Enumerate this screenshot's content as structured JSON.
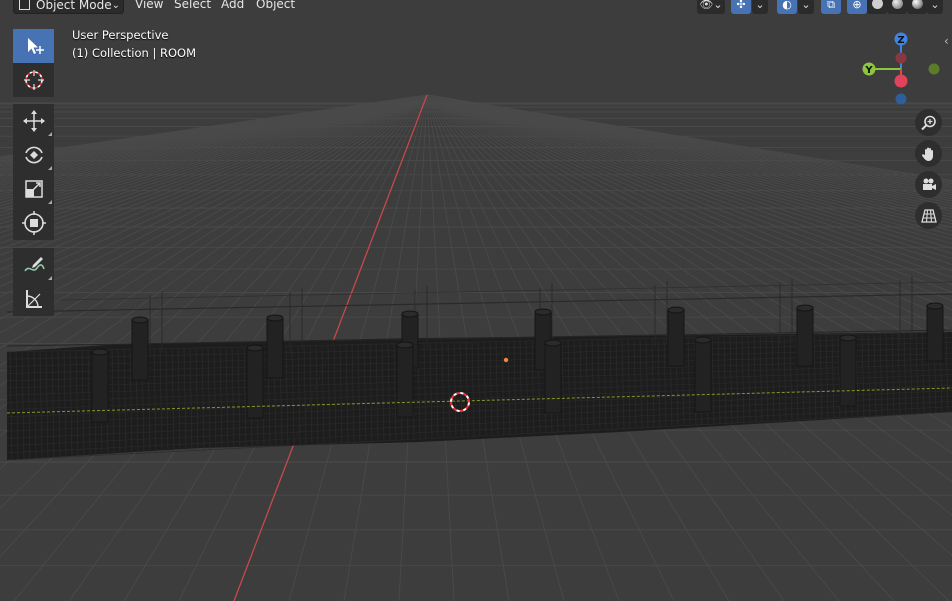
{
  "header": {
    "mode": "Object Mode",
    "menus": [
      "View",
      "Select",
      "Add",
      "Object"
    ]
  },
  "overlay": {
    "view_name": "User Perspective",
    "collection_info": "(1) Collection | ROOM"
  },
  "gizmo": {
    "z_label": "Z",
    "y_label": "Y"
  },
  "colors": {
    "accent": "#4772b3",
    "x_axis": "#e2435b",
    "y_axis": "#8cc63e",
    "z_axis": "#3d84e6",
    "origin": "#f0873a"
  },
  "icons": {
    "tools": [
      "select-box-icon",
      "cursor-icon",
      "move-icon",
      "rotate-icon",
      "scale-icon",
      "transform-icon",
      "annotate-icon",
      "measure-icon"
    ],
    "nav": [
      "zoom-icon",
      "hand-pan-icon",
      "camera-icon",
      "grid-ortho-icon"
    ]
  }
}
